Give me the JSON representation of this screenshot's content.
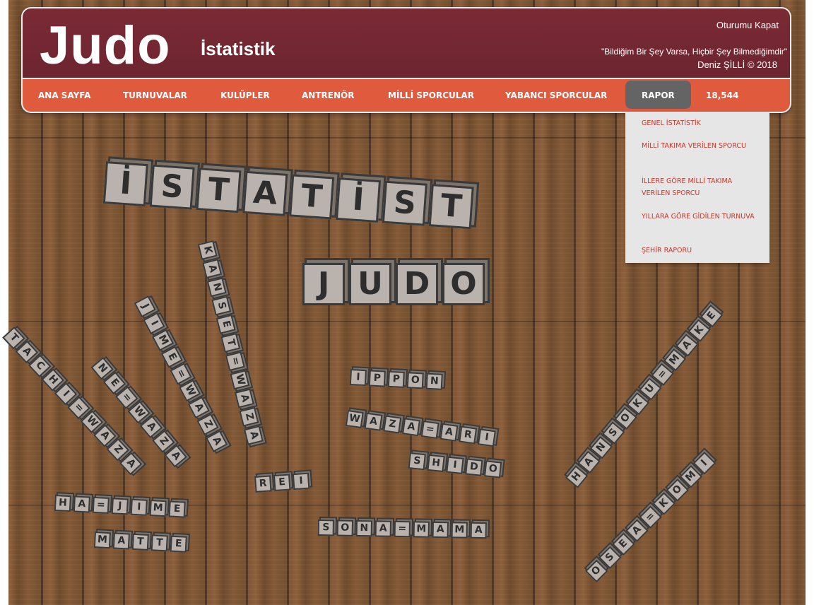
{
  "header": {
    "logo": "Judo",
    "logo_sub": "İstatistik",
    "logout": "Oturumu Kapat",
    "quote": "\"Bildiğim Bir Şey Varsa, Hiçbir Şey Bilmediğimdir\"",
    "author": "Deniz ŞİLLİ ©  2018"
  },
  "nav": {
    "items": [
      "ANA SAYFA",
      "TURNUVALAR",
      "KULÜPLER",
      "ANTRENÖR",
      "MİLLİ SPORCULAR",
      "YABANCI SPORCULAR",
      "RAPOR",
      "18,544"
    ],
    "active": "RAPOR"
  },
  "dropdown": {
    "items": [
      "GENEL İSTATİSTİK",
      "MİLLİ TAKIMA VERİLEN SPORCU",
      "İLLERE GÖRE MİLLİ TAKIMA VERİLEN SPORCU",
      "YILLARA GÖRE GİDİLEN TURNUVA",
      "ŞEHİR RAPORU"
    ]
  },
  "banner": {
    "title_letters": [
      "İ",
      "S",
      "T",
      "A",
      "T",
      "İ",
      "S",
      "T"
    ],
    "judo_letters": [
      "J",
      "U",
      "D",
      "O"
    ],
    "words": {
      "ippon": [
        "I",
        "P",
        "P",
        "O",
        "N"
      ],
      "waza_ari": [
        "W",
        "A",
        "Z",
        "A",
        "=",
        "A",
        "R",
        "I"
      ],
      "shido": [
        "S",
        "H",
        "I",
        "D",
        "O"
      ],
      "rei": [
        "R",
        "E",
        "I"
      ],
      "sono_mama": [
        "S",
        "O",
        "N",
        "A",
        "=",
        "M",
        "A",
        "M",
        "A"
      ],
      "hajime": [
        "H",
        "A",
        "=",
        "J",
        "I",
        "M",
        "E"
      ],
      "matte": [
        "M",
        "A",
        "T",
        "T",
        "E"
      ],
      "tachi_waza": [
        "T",
        "A",
        "C",
        "H",
        "I",
        "=",
        "W",
        "A",
        "Z",
        "A"
      ],
      "ne_waza": [
        "N",
        "E",
        "=",
        "W",
        "A",
        "Z",
        "A"
      ],
      "jime_waza": [
        "J",
        "I",
        "M",
        "E",
        "=",
        "W",
        "A",
        "Z",
        "A"
      ],
      "kansetsu_waza": [
        "K",
        "A",
        "N",
        "S",
        "E",
        "T",
        "=",
        "W",
        "A",
        "Z",
        "A"
      ],
      "hansoku_make": [
        "H",
        "A",
        "N",
        "S",
        "O",
        "K",
        "U",
        "=",
        "M",
        "A",
        "K",
        "E"
      ],
      "osaekomi": [
        "O",
        "S",
        "E",
        "A",
        "=",
        "K",
        "O",
        "M",
        "I"
      ]
    }
  }
}
